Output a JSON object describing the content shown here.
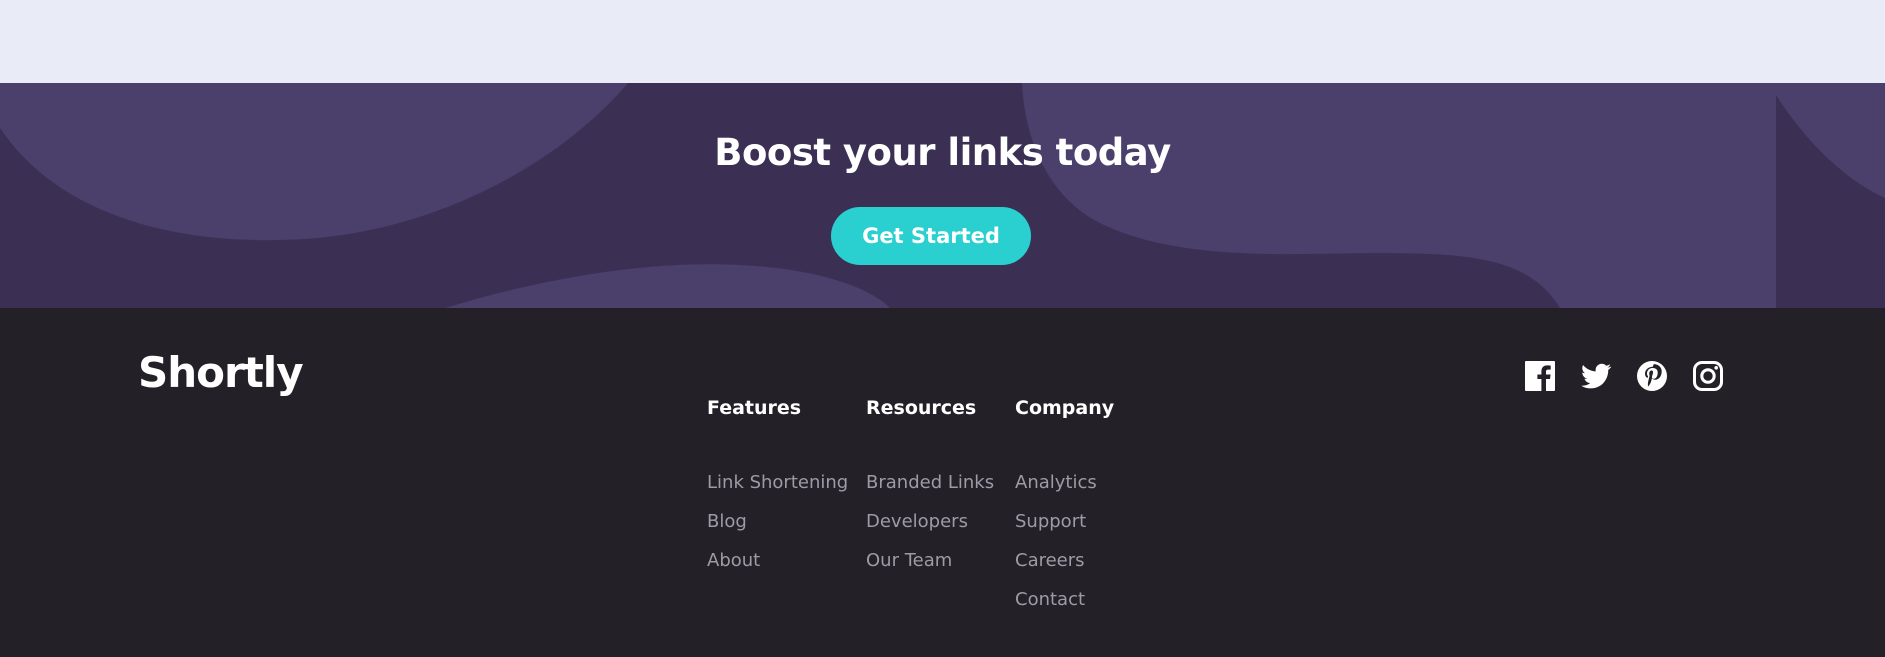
{
  "boost": {
    "title": "Boost your links today",
    "cta_label": "Get Started"
  },
  "footer": {
    "logo": "Shortly",
    "columns": [
      {
        "heading": "Features",
        "links": [
          "Link Shortening",
          "Blog",
          "About"
        ]
      },
      {
        "heading": "Resources",
        "links": [
          "Branded Links",
          "Developers",
          "Our Team"
        ]
      },
      {
        "heading": "Company",
        "links": [
          "Analytics",
          "Support",
          "Careers",
          "Contact"
        ]
      }
    ],
    "social_icons": [
      "facebook-icon",
      "twitter-icon",
      "pinterest-icon",
      "instagram-icon"
    ]
  },
  "colors": {
    "page_bg": "#e9ebf7",
    "boost_bg": "#3b3054",
    "boost_shape": "#4b3f6b",
    "cta": "#2acfcf",
    "footer_bg": "#232127",
    "footer_link": "#9e9aa7",
    "white": "#ffffff"
  }
}
